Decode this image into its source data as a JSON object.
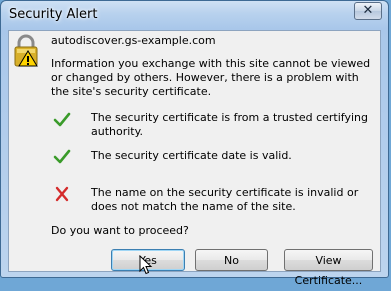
{
  "window": {
    "title": "Security Alert",
    "close_label": "✕"
  },
  "alert": {
    "site": "autodiscover.gs-example.com",
    "info": "Information you exchange with this site cannot be viewed or changed by others. However, there is a problem with the site's security certificate."
  },
  "checks": [
    {
      "status": "ok",
      "icon": "checkmark-icon",
      "text": "The security certificate is from a trusted certifying authority."
    },
    {
      "status": "ok",
      "icon": "checkmark-icon",
      "text": "The security certificate date is valid."
    },
    {
      "status": "error",
      "icon": "red-x-icon",
      "text": "The name on the security certificate is invalid or does not match the name of the site."
    }
  ],
  "question": "Do you want to proceed?",
  "buttons": {
    "yes": "Yes",
    "no": "No",
    "view": "View Certificate..."
  },
  "colors": {
    "ok": "#3a9b2a",
    "error": "#d42b2b",
    "title_bg": "#b9d2ee",
    "client_bg": "#f0f0f0"
  }
}
